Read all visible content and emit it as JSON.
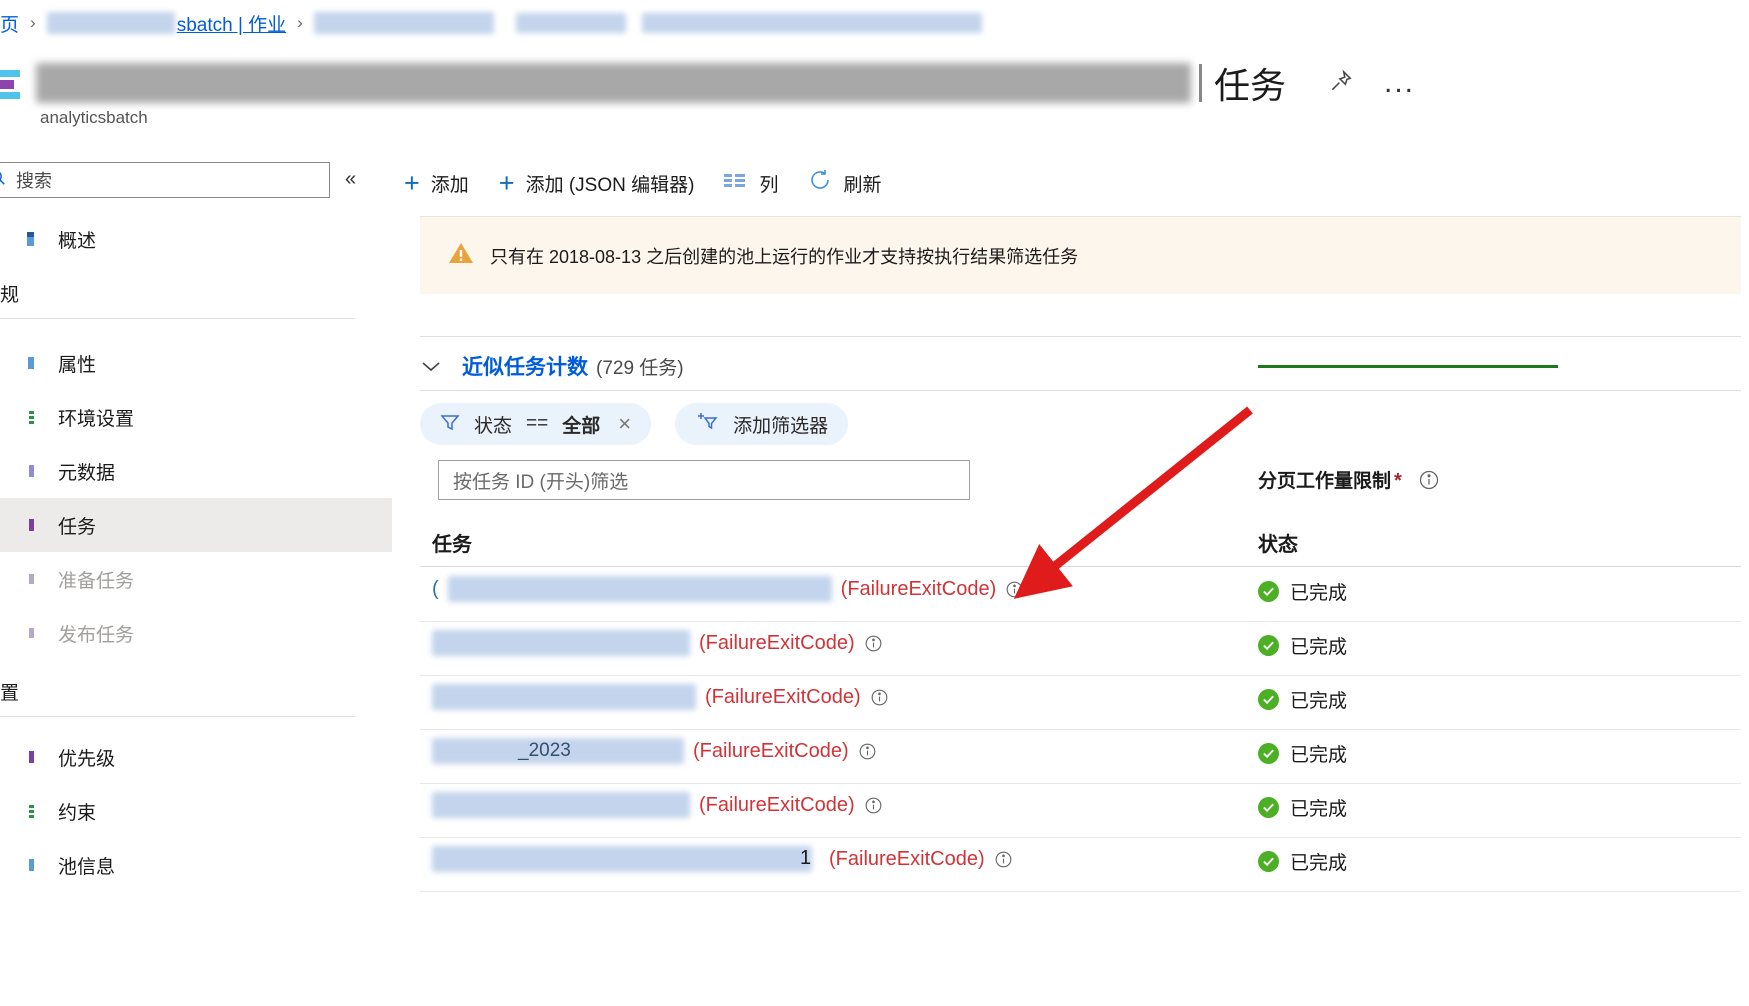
{
  "breadcrumb": {
    "home_label": "页",
    "redacted_1": "",
    "link_label": "sbatch | 作业",
    "redacted_2": "",
    "separator": "›"
  },
  "header": {
    "title_redacted": "",
    "title_suffix": "任务",
    "subtitle": "analyticsbatch",
    "pin_title": "pin",
    "more_title": "..."
  },
  "sidebar": {
    "search_placeholder": "搜索",
    "collapse_label": "«",
    "items": [
      {
        "label": "概述",
        "icon": "overview-icon",
        "state": "normal"
      }
    ],
    "groups": [
      {
        "label": "规",
        "items": [
          {
            "label": "属性",
            "icon": "properties-icon",
            "state": "normal"
          },
          {
            "label": "环境设置",
            "icon": "environment-icon",
            "state": "normal"
          },
          {
            "label": "元数据",
            "icon": "metadata-icon",
            "state": "normal"
          },
          {
            "label": "任务",
            "icon": "tasks-icon",
            "state": "selected"
          },
          {
            "label": "准备任务",
            "icon": "prep-task-icon",
            "state": "disabled"
          },
          {
            "label": "发布任务",
            "icon": "release-task-icon",
            "state": "disabled"
          }
        ]
      },
      {
        "label": "置",
        "items": [
          {
            "label": "优先级",
            "icon": "priority-icon",
            "state": "normal"
          },
          {
            "label": "约束",
            "icon": "constraints-icon",
            "state": "normal"
          },
          {
            "label": "池信息",
            "icon": "pool-info-icon",
            "state": "normal"
          }
        ]
      }
    ]
  },
  "toolbar": {
    "add_label": "添加",
    "add_json_label": "添加 (JSON 编辑器)",
    "columns_label": "列",
    "refresh_label": "刷新"
  },
  "warning": {
    "text": "只有在 2018-08-13 之后创建的池上运行的作业才支持按执行结果筛选任务"
  },
  "section": {
    "chevron": "∨",
    "title": "近似任务计数",
    "count": "(729 任务)"
  },
  "filters": {
    "status_pill": {
      "field": "状态",
      "operator": "==",
      "value": "全部",
      "remove": "×"
    },
    "add_filter_label": "添加筛选器",
    "id_filter_placeholder": "按任务 ID (开头)筛选"
  },
  "page_limit": {
    "label": "分页工作量限制",
    "required_mark": "*"
  },
  "table": {
    "columns": [
      "任务",
      "状态"
    ],
    "rows": [
      {
        "name_redacted": "",
        "name_width": 384,
        "prefix": "(",
        "suffix": "(FailureExitCode)",
        "status": "已完成"
      },
      {
        "name_redacted": "",
        "name_width": 258,
        "prefix": "",
        "suffix": "(FailureExitCode)",
        "status": "已完成"
      },
      {
        "name_redacted": "",
        "name_width": 264,
        "prefix": "",
        "suffix": "(FailureExitCode)",
        "status": "已完成"
      },
      {
        "name_redacted": "_2023",
        "name_width": 252,
        "prefix": "",
        "suffix": "(FailureExitCode)",
        "status": "已完成"
      },
      {
        "name_redacted": "",
        "name_width": 258,
        "prefix": "",
        "suffix": "(FailureExitCode)",
        "status": "已完成"
      },
      {
        "name_redacted": "1",
        "name_width": 380,
        "prefix": "",
        "suffix": "(FailureExitCode)",
        "status": "已完成"
      }
    ]
  },
  "colors": {
    "link": "#015cda",
    "error": "#d13438",
    "success": "#4caf26",
    "warning_bg": "#fdf6ec",
    "accent_rule": "#1f7a1f",
    "arrow": "#e01b1b"
  }
}
